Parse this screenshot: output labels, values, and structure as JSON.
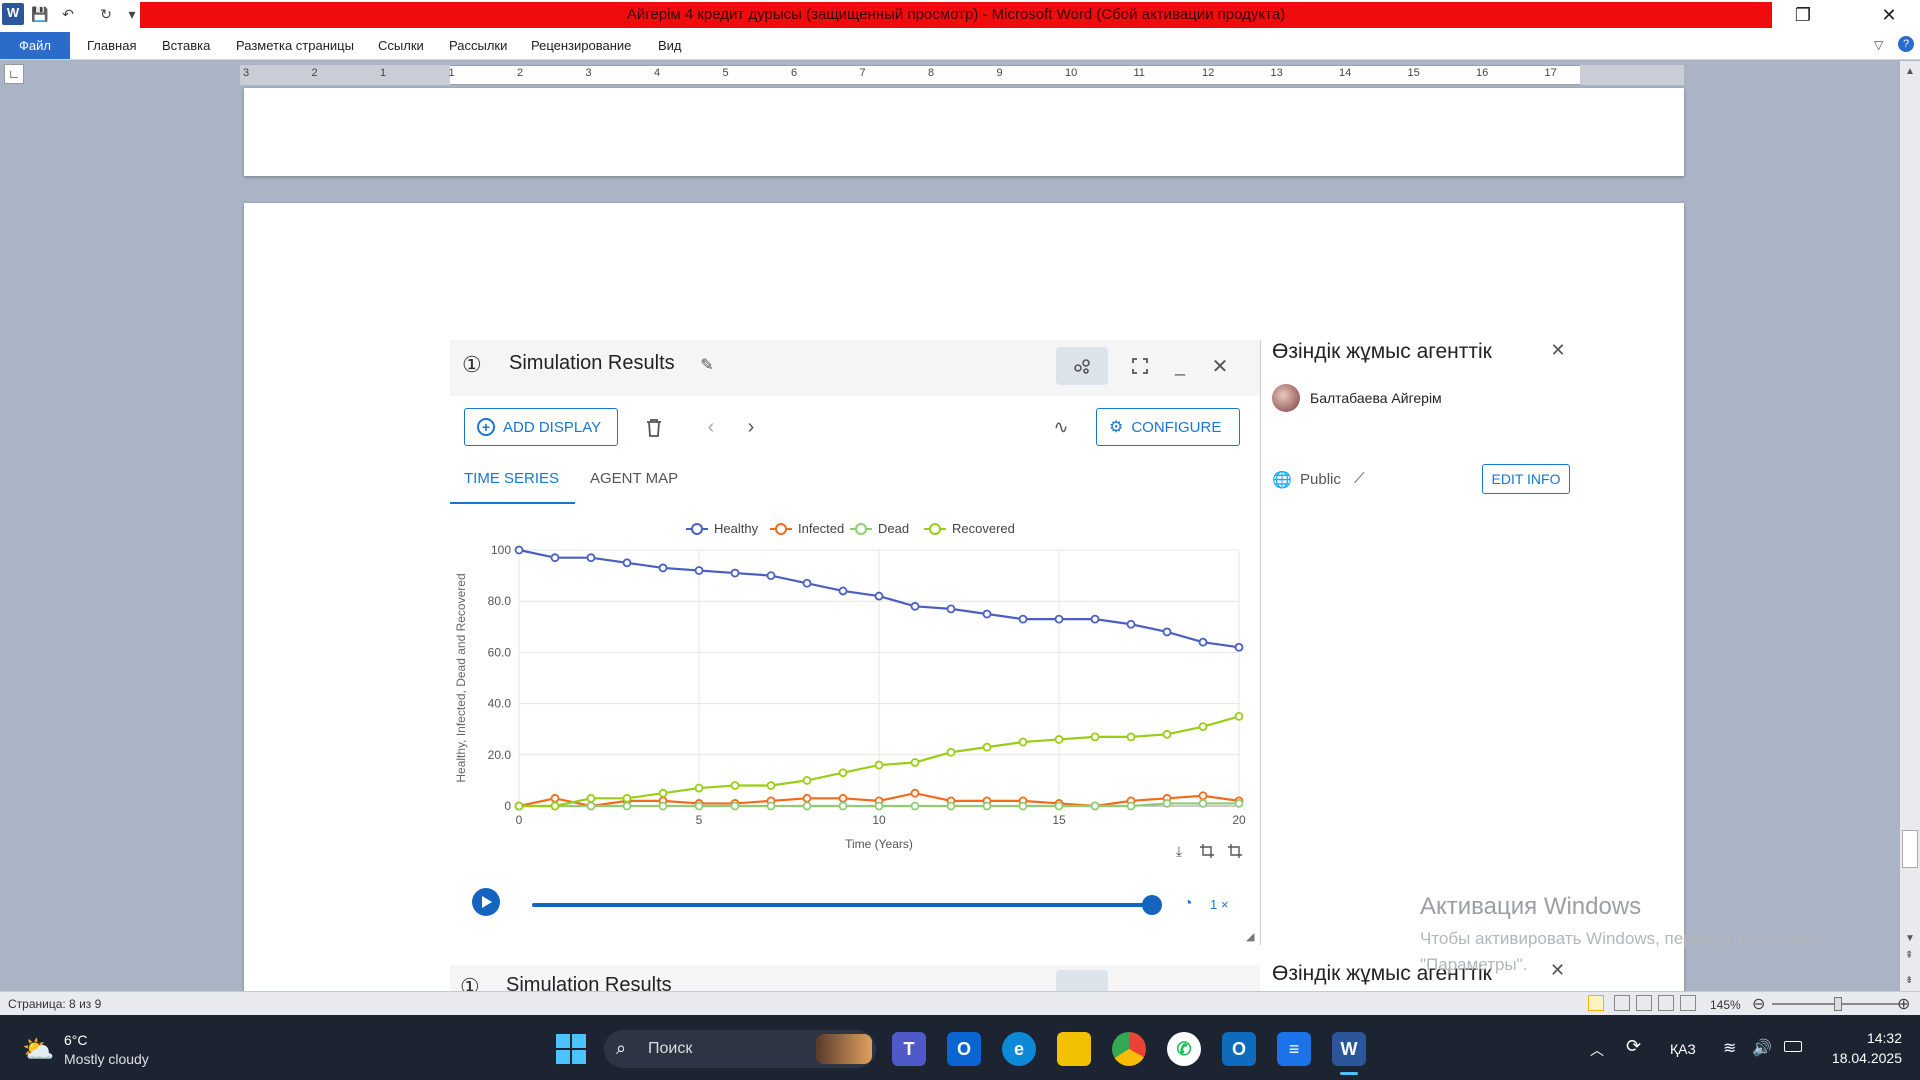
{
  "window": {
    "title": "Айгерім 4 кредит дурысы (защищенный просмотр) - Microsoft Word (Сбой активации продукта)"
  },
  "ribbon": {
    "tabs": [
      "Файл",
      "Главная",
      "Вставка",
      "Разметка страницы",
      "Ссылки",
      "Рассылки",
      "Рецензирование",
      "Вид"
    ]
  },
  "ruler": {
    "labels": [
      "3",
      "2",
      "1",
      "1",
      "2",
      "3",
      "4",
      "5",
      "6",
      "7",
      "8",
      "9",
      "10",
      "11",
      "12",
      "13",
      "14",
      "15",
      "16",
      "17"
    ]
  },
  "card": {
    "number": "①",
    "title": "Simulation Results",
    "add_display": "ADD DISPLAY",
    "configure": "CONFIGURE",
    "tabs": [
      "TIME SERIES",
      "AGENT MAP"
    ],
    "speed": "1 ×"
  },
  "card2": {
    "number": "①",
    "title": "Simulation Results"
  },
  "side_panel": {
    "title": "Өзіндік жұмыс агенттік",
    "author": "Балтабаева Айгерім",
    "visibility": "Public",
    "edit_info": "EDIT INFO"
  },
  "side_panel2": {
    "title": "Өзіндік жұмыс агенттік"
  },
  "chart_data": {
    "type": "line",
    "xlabel": "Time (Years)",
    "ylabel": "Healthy, Infected, Dead and Recovered",
    "xlim": [
      0,
      20
    ],
    "ylim": [
      0,
      100
    ],
    "x_ticks": [
      "0",
      "5",
      "10",
      "15",
      "20"
    ],
    "y_ticks": [
      "0",
      "20.0",
      "40.0",
      "60.0",
      "80.0",
      "100"
    ],
    "legend_position": "top",
    "grid": true,
    "x": [
      0,
      1,
      2,
      3,
      4,
      5,
      6,
      7,
      8,
      9,
      10,
      11,
      12,
      13,
      14,
      15,
      16,
      17,
      18,
      19,
      20
    ],
    "series": [
      {
        "name": "Healthy",
        "color": "#4a5fc1",
        "values": [
          100,
          97,
          97,
          95,
          93,
          92,
          91,
          90,
          87,
          84,
          82,
          78,
          77,
          75,
          73,
          73,
          73,
          71,
          68,
          64,
          62
        ]
      },
      {
        "name": "Infected",
        "color": "#f26b1d",
        "values": [
          0,
          3,
          0,
          2,
          2,
          1,
          1,
          2,
          3,
          3,
          2,
          5,
          2,
          2,
          2,
          1,
          0,
          2,
          3,
          4,
          2
        ]
      },
      {
        "name": "Dead",
        "color": "#91cc75",
        "values": [
          0,
          0,
          0,
          0,
          0,
          0,
          0,
          0,
          0,
          0,
          0,
          0,
          0,
          0,
          0,
          0,
          0,
          0,
          1,
          1,
          1
        ]
      },
      {
        "name": "Recovered",
        "color": "#9acd17",
        "values": [
          0,
          0,
          3,
          3,
          5,
          7,
          8,
          8,
          10,
          13,
          16,
          17,
          21,
          23,
          25,
          26,
          27,
          27,
          28,
          31,
          35
        ]
      }
    ]
  },
  "watermark": {
    "title": "Активация Windows",
    "line": "Чтобы активировать Windows, перейдите в раздел \"Параметры\"."
  },
  "status": {
    "page": "Страница: 8 из 9",
    "zoom": "145%"
  },
  "taskbar": {
    "weather_temp": "6°C",
    "weather_desc": "Mostly cloudy",
    "search": "Поиск",
    "lang": "ҚАЗ",
    "time": "14:32",
    "date": "18.04.2025"
  }
}
